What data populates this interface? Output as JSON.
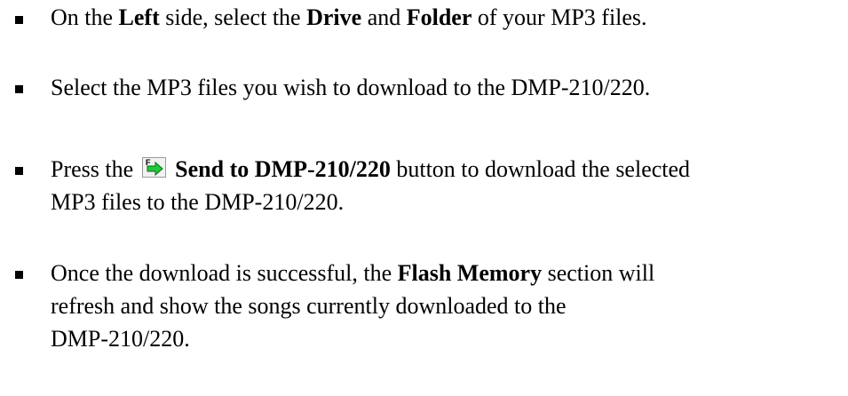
{
  "instructions": [
    {
      "parts": [
        {
          "text": "On the ",
          "bold": false
        },
        {
          "text": "Left",
          "bold": true
        },
        {
          "text": " side, select the ",
          "bold": false
        },
        {
          "text": "Drive",
          "bold": true
        },
        {
          "text": " and ",
          "bold": false
        },
        {
          "text": "Folder",
          "bold": true
        },
        {
          "text": " of your MP3 files.",
          "bold": false
        }
      ]
    },
    {
      "text": "Select the MP3 files you wish to download to the DMP-210/220."
    },
    {
      "before_icon": "Press the",
      "icon": "send-to-device-icon",
      "button_label": "Send to DMP-210/220",
      "after_label": " button to download the selected",
      "line2": "MP3 files to the DMP-210/220."
    },
    {
      "line1_before": "Once the download is successful, the ",
      "bold_term": "Flash Memory",
      "line1_after": " section will",
      "line2": "refresh and show the songs currently downloaded to the",
      "line3": "DMP-210/220."
    }
  ],
  "colors": {
    "text": "#000000",
    "bullet": "#000000",
    "icon_arrow": "#22c83a",
    "icon_bg": "#f2f2f2"
  }
}
